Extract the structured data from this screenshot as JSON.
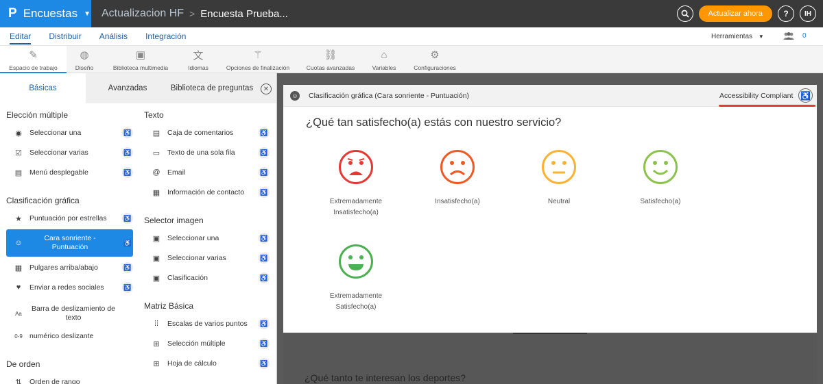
{
  "topbar": {
    "logo_glyph": "P",
    "app_name": "Encuestas",
    "breadcrumb_project": "Actualizacion HF",
    "breadcrumb_sep": ">",
    "breadcrumb_survey": "Encuesta Prueba...",
    "update_label": "Actualizar ahora",
    "help_glyph": "?",
    "avatar_initials": "IH"
  },
  "nav": {
    "tabs": [
      "Editar",
      "Distribuir",
      "Análisis",
      "Integración"
    ],
    "tools_label": "Herramientas",
    "users_count": "0"
  },
  "toolbar": {
    "items": [
      "Espacio de trabajo",
      "Diseño",
      "Biblioteca multimedia",
      "Idiomas",
      "Opciones de finalización",
      "Cuotas avanzadas",
      "Variables",
      "Configuraciones"
    ]
  },
  "left": {
    "tabs": [
      "Básicas",
      "Avanzadas",
      "Biblioteca de preguntas"
    ],
    "col1": {
      "sec_multiple": "Elección múltiple",
      "sel_una": "Seleccionar una",
      "sel_varias": "Seleccionar varias",
      "menu": "Menú desplegable",
      "sec_grafica": "Clasificación gráfica",
      "estrellas": "Puntuación por estrellas",
      "cara": "Cara sonriente - Puntuación",
      "pulgares": "Pulgares arriba/abajo",
      "redes": "Enviar a redes sociales",
      "barra": "Barra de deslizamiento de texto",
      "numerico": "numérico deslizante",
      "sec_orden": "De orden",
      "orden_rango": "Orden de rango"
    },
    "col2": {
      "sec_texto": "Texto",
      "comentarios": "Caja de comentarios",
      "una_fila": "Texto de una sola fila",
      "email": "Email",
      "contacto": "Información de contacto",
      "sec_imagen": "Selector imagen",
      "img_una": "Seleccionar una",
      "img_varias": "Seleccionar varias",
      "img_clasif": "Clasificación",
      "sec_matriz": "Matriz Básica",
      "escalas": "Escalas de varios puntos",
      "multiple": "Selección múltiple",
      "hoja": "Hoja de cálculo"
    }
  },
  "card": {
    "header_title": "Clasificación gráfica (Cara sonriente - Puntuación)",
    "accessibility_label": "Accessibility Compliant",
    "question": "¿Qué tan satisfecho(a) estás con nuestro servicio?",
    "faces": [
      {
        "label": "Extremadamente Insatisfecho(a)",
        "color": "#e53935",
        "mood": "very-sad"
      },
      {
        "label": "Insatisfecho(a)",
        "color": "#ef5a24",
        "mood": "sad"
      },
      {
        "label": "Neutral",
        "color": "#f9b233",
        "mood": "neutral"
      },
      {
        "label": "Satisfecho(a)",
        "color": "#8bc34a",
        "mood": "happy"
      },
      {
        "label": "Extremadamente Satisfecho(a)",
        "color": "#4caf50",
        "mood": "very-happy"
      }
    ]
  },
  "next_question": "¿Qué tanto te interesan los deportes?",
  "colors": {
    "accent": "#1e88e5",
    "update": "#ff9800",
    "highlight": "#e53935"
  }
}
